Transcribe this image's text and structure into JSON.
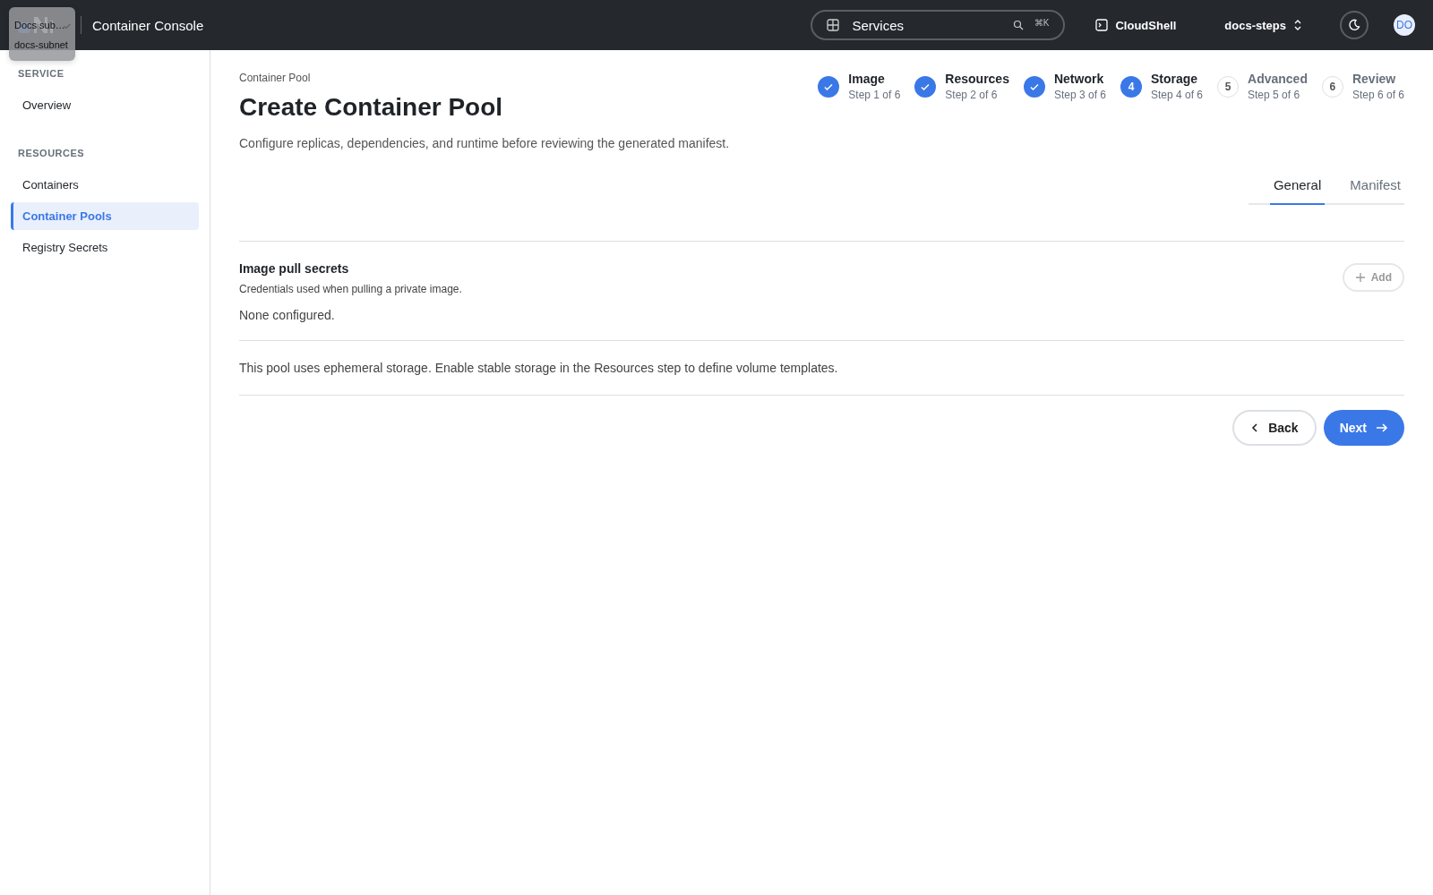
{
  "header": {
    "title": "Container Console",
    "search": {
      "value": "Services",
      "shortcut": "⌘K"
    },
    "cloudshell": "CloudShell",
    "project": "docs-steps",
    "avatar": "DO"
  },
  "popup": {
    "title": "Docs sub…",
    "subtitle": "docs-subnet",
    "checked": true
  },
  "sidebar": {
    "sections": [
      {
        "heading": "SERVICE",
        "items": [
          {
            "label": "Overview",
            "selected": false
          }
        ]
      },
      {
        "heading": "RESOURCES",
        "items": [
          {
            "label": "Containers",
            "selected": false
          },
          {
            "label": "Container Pools",
            "selected": true
          },
          {
            "label": "Registry Secrets",
            "selected": false
          }
        ]
      }
    ]
  },
  "page": {
    "breadcrumb": "Container Pool",
    "title": "Create Container Pool",
    "description": "Configure replicas, dependencies, and runtime before reviewing the generated manifest."
  },
  "steps": [
    {
      "label": "Image",
      "sub": "Step 1 of 6",
      "kind": "done"
    },
    {
      "label": "Resources",
      "sub": "Step 2 of 6",
      "kind": "done"
    },
    {
      "label": "Network",
      "sub": "Step 3 of 6",
      "kind": "done"
    },
    {
      "marker": "4",
      "label": "Storage",
      "sub": "Step 4 of 6",
      "kind": "current"
    },
    {
      "marker": "5",
      "label": "Advanced",
      "sub": "Step 5 of 6",
      "kind": "upcoming"
    },
    {
      "marker": "6",
      "label": "Review",
      "sub": "Step 6 of 6",
      "kind": "upcoming"
    }
  ],
  "tabs": [
    {
      "label": "General",
      "selected": true
    },
    {
      "label": "Manifest",
      "selected": false
    }
  ],
  "secrets": {
    "title": "Image pull secrets",
    "subtitle": "Credentials used when pulling a private image.",
    "add": "Add",
    "add_disabled": true,
    "empty": "None configured."
  },
  "note": "This pool uses ephemeral storage. Enable stable storage in the Resources step to define volume templates.",
  "buttons": {
    "back": "Back",
    "next": "Next"
  }
}
